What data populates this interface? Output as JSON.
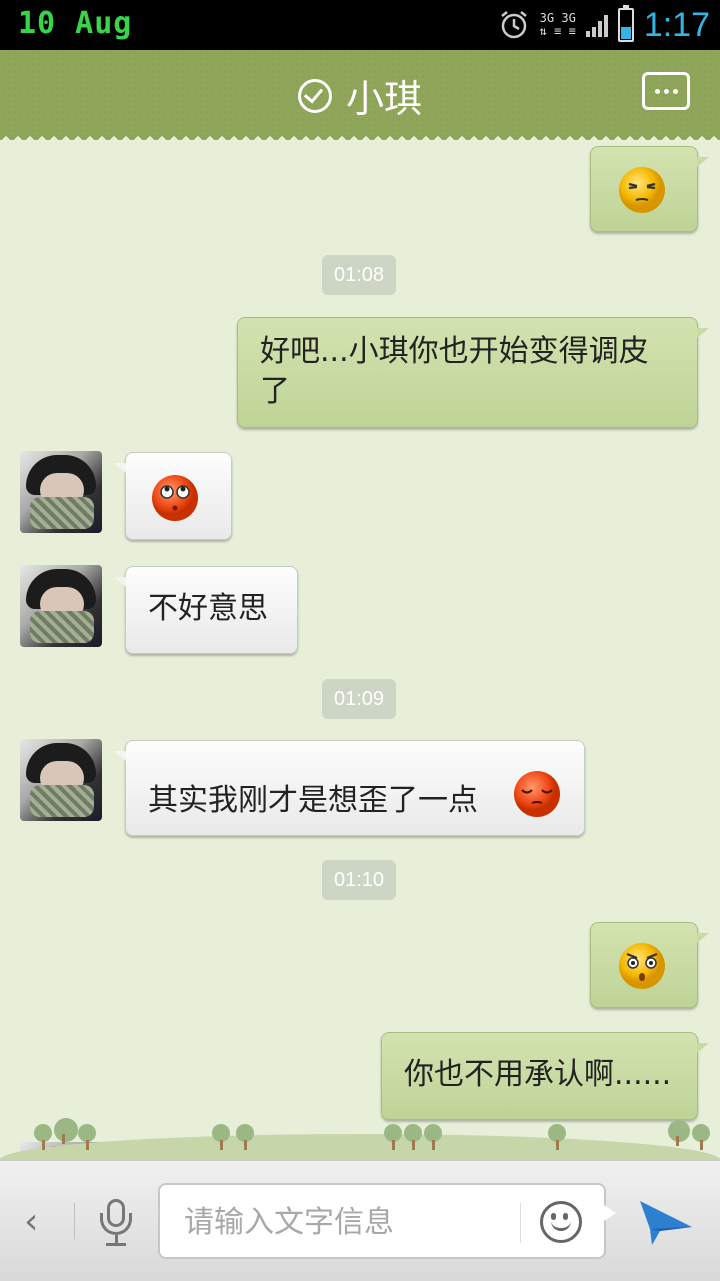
{
  "status_bar": {
    "date": "10 Aug",
    "time": "1:17",
    "network": "3G",
    "battery_icon": "battery-icon",
    "alarm_icon": "alarm-icon"
  },
  "header": {
    "title": "小琪",
    "verified_icon": "check-circle-icon",
    "menu_icon": "more-icon"
  },
  "messages": [
    {
      "side": "me",
      "emoji": "squint-emoji"
    },
    {
      "timestamp": "01:08"
    },
    {
      "side": "me",
      "text": "好吧...小琪你也开始变得调皮\n了"
    },
    {
      "side": "them",
      "emoji": "rolling-eyes-emoji"
    },
    {
      "side": "them",
      "text": "不好意思"
    },
    {
      "timestamp": "01:09"
    },
    {
      "side": "them",
      "text": "其实我刚才是想歪了一点",
      "emoji": "shy-emoji"
    },
    {
      "timestamp": "01:10"
    },
    {
      "side": "me",
      "emoji": "shocked-emoji"
    },
    {
      "side": "me",
      "text": "你也不用承认啊......"
    }
  ],
  "input_bar": {
    "placeholder": "请输入文字信息",
    "back_icon": "chevron-left-icon",
    "voice_icon": "microphone-icon",
    "emoji_icon": "smiley-icon",
    "send_icon": "send-icon"
  },
  "colors": {
    "header_bg": "#8ea55a",
    "chat_bg": "#e7efd9",
    "my_bubble": "#c8dba3",
    "their_bubble": "#f3f3f3",
    "time_accent": "#33b5e5",
    "date_accent": "#37d64a"
  }
}
